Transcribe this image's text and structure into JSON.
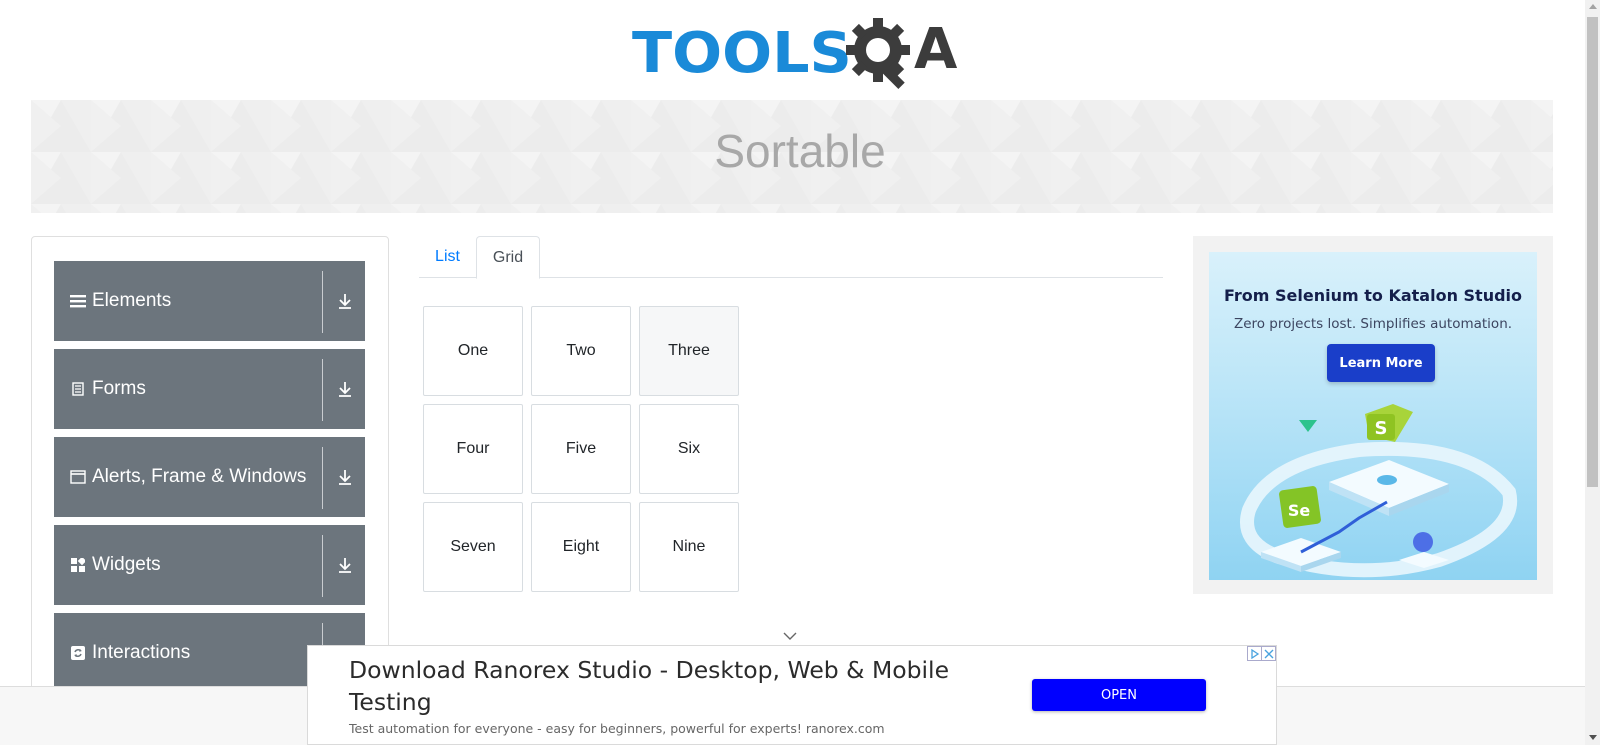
{
  "logo": {
    "part1": "TOOLS",
    "part2": "A"
  },
  "banner": {
    "title": "Sortable"
  },
  "sidebar": {
    "groups": [
      {
        "label": "Elements",
        "icon": "hamburger-icon"
      },
      {
        "label": "Forms",
        "icon": "document-icon"
      },
      {
        "label": "Alerts, Frame & Windows",
        "icon": "window-icon"
      },
      {
        "label": "Widgets",
        "icon": "widgets-icon"
      },
      {
        "label": "Interactions",
        "icon": "refresh-icon"
      }
    ]
  },
  "tabs": {
    "list": "List",
    "grid": "Grid",
    "active": "Grid"
  },
  "grid": {
    "items": [
      "One",
      "Two",
      "Three",
      "Four",
      "Five",
      "Six",
      "Seven",
      "Eight",
      "Nine"
    ],
    "hovered": "Three"
  },
  "right_ad": {
    "title": "From Selenium to Katalon Studio",
    "subtitle": "Zero projects lost. Simplifies automation.",
    "button": "Learn More",
    "badge_s": "S",
    "badge_se": "Se"
  },
  "bottom_ad": {
    "headline": "Download Ranorex Studio - Desktop, Web & Mobile Testing",
    "description": "Test automation for everyone - easy for beginners, powerful for experts! ranorex.com",
    "button": "OPEN"
  },
  "colors": {
    "accent_blue": "#1a8ad8",
    "sidebar_gray": "#6c757d",
    "tab_link": "#007bff",
    "open_button": "#0000ff"
  }
}
